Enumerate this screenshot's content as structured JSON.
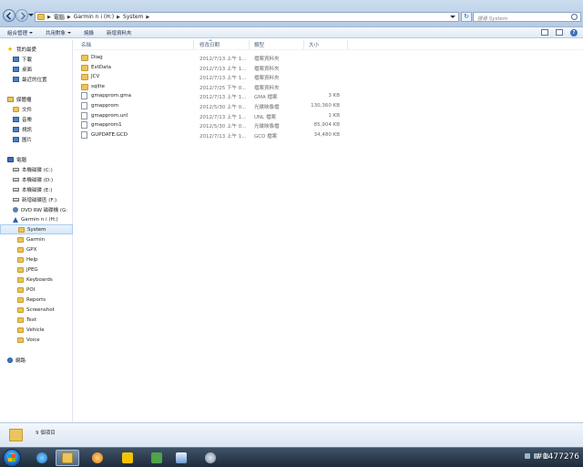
{
  "address": {
    "crumbs": [
      "電腦",
      "Garmin n i (H:)",
      "System"
    ],
    "search_placeholder": "搜尋 System"
  },
  "toolbar": {
    "organize": "組合管理",
    "share": "共用對象",
    "burn": "燒錄",
    "new_folder": "新增資料夾",
    "help": "?"
  },
  "nav": {
    "favorites": "我的最愛",
    "fav_items": [
      "下載",
      "桌面",
      "最近的位置"
    ],
    "libraries": "媒體櫃",
    "lib_items": [
      "文件",
      "音樂",
      "視訊",
      "圖片"
    ],
    "computer": "電腦",
    "drives": [
      "本機磁碟 (C:)",
      "本機磁碟 (D:)",
      "本機磁碟 (E:)",
      "新增磁碟區 (F:)",
      "DVD RW 磁碟機 (G:",
      "Garmin n i (H:)"
    ],
    "folders": [
      "System",
      "Garmin",
      "GPX",
      "Help",
      "JPEG",
      "Keyboards",
      "POI",
      "Reports",
      "Screenshot",
      "Text",
      "Vehicle",
      "Voice"
    ],
    "network": "網路"
  },
  "columns": {
    "name": "名稱",
    "date": "修改日期",
    "type": "類型",
    "size": "大小"
  },
  "files": [
    {
      "name": "Diag",
      "date": "2012/7/13 上午 1...",
      "type": "檔案資料夾",
      "size": "",
      "kind": "folder"
    },
    {
      "name": "ExtData",
      "date": "2012/7/13 上午 1...",
      "type": "檔案資料夾",
      "size": "",
      "kind": "folder"
    },
    {
      "name": "JCV",
      "date": "2012/7/13 上午 1...",
      "type": "檔案資料夾",
      "size": "",
      "kind": "folder"
    },
    {
      "name": "sqlite",
      "date": "2012/7/25 下午 0...",
      "type": "檔案資料夾",
      "size": "",
      "kind": "folder"
    },
    {
      "name": "gmapprom.gma",
      "date": "2012/7/13 上午 1...",
      "type": "GMA 檔案",
      "size": "3 KB",
      "kind": "file"
    },
    {
      "name": "gmapprom",
      "date": "2012/5/30 上午 0...",
      "type": "光碟映像檔",
      "size": "130,360 KB",
      "kind": "file"
    },
    {
      "name": "gmapprom.unl",
      "date": "2012/7/13 上午 1...",
      "type": "UNL 檔案",
      "size": "1 KB",
      "kind": "file"
    },
    {
      "name": "gmapprom1",
      "date": "2012/5/30 上午 0...",
      "type": "光碟映像檔",
      "size": "85,904 KB",
      "kind": "file"
    },
    {
      "name": "GUPDATE.GCD",
      "date": "2012/7/13 上午 1...",
      "type": "GCD 檔案",
      "size": "34,480 KB",
      "kind": "file"
    }
  ],
  "status": {
    "count": "9 個項目"
  },
  "watermark": "#1477276",
  "colors": {
    "folder": "#eac45c",
    "selection": "#d6e8fa",
    "taskbar": "#2a3a4d"
  }
}
